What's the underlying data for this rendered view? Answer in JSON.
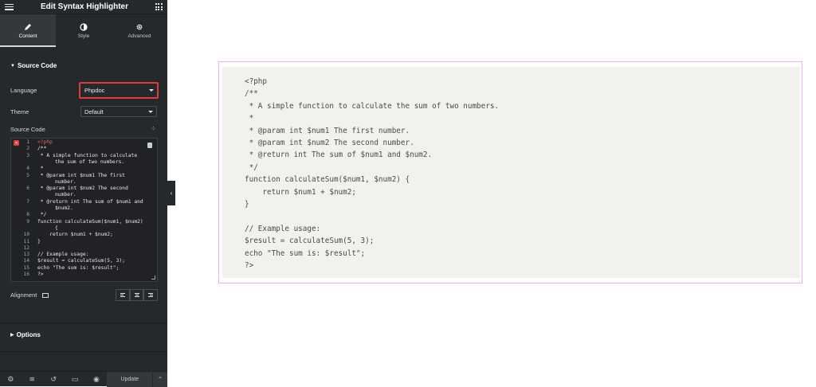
{
  "sidebar": {
    "title": "Edit Syntax Highlighter",
    "tabs": [
      {
        "label": "Content",
        "icon": "pencil-icon"
      },
      {
        "label": "Style",
        "icon": "contrast-icon"
      },
      {
        "label": "Advanced",
        "icon": "gear-icon"
      }
    ],
    "section_source": "Source Code",
    "language_label": "Language",
    "language_value": "Phpdoc",
    "theme_label": "Theme",
    "theme_value": "Default",
    "source_label": "Source Code",
    "alignment_label": "Alignment",
    "section_options": "Options",
    "update_label": "Update",
    "editor_lines": [
      {
        "n": "1",
        "t": "<?php"
      },
      {
        "n": "2",
        "t": "/**"
      },
      {
        "n": "3",
        "t": " * A simple function to calculate",
        "w": "the sum of two numbers."
      },
      {
        "n": "4",
        "t": " *"
      },
      {
        "n": "5",
        "t": " * @param int $num1 The first",
        "w": "number."
      },
      {
        "n": "6",
        "t": " * @param int $num2 The second",
        "w": "number."
      },
      {
        "n": "7",
        "t": " * @return int The sum of $num1 and",
        "w": "$num2."
      },
      {
        "n": "8",
        "t": " */"
      },
      {
        "n": "9",
        "t": "function calculateSum($num1, $num2)",
        "w": "{"
      },
      {
        "n": "10",
        "t": "    return $num1 + $num2;"
      },
      {
        "n": "11",
        "t": "}"
      },
      {
        "n": "12",
        "t": ""
      },
      {
        "n": "13",
        "t": "// Example usage:"
      },
      {
        "n": "14",
        "t": "$result = calculateSum(5, 3);"
      },
      {
        "n": "15",
        "t": "echo \"The sum is: $result\";"
      },
      {
        "n": "16",
        "t": "?>"
      }
    ]
  },
  "preview": {
    "lines": [
      "<?php",
      "/**",
      " * A simple function to calculate the sum of two numbers.",
      " *",
      " * @param int $num1 The first number.",
      " * @param int $num2 The second number.",
      " * @return int The sum of $num1 and $num2.",
      " */",
      "function calculateSum($num1, $num2) {",
      "    return $num1 + $num2;",
      "}",
      "",
      "// Example usage:",
      "$result = calculateSum(5, 3);",
      "echo \"The sum is: $result\";",
      "?>"
    ]
  },
  "colors": {
    "panel": "#26292c",
    "highlight": "#e03b3b",
    "preview_border": "#e8b4ec",
    "preview_bg": "#f3f1ee"
  }
}
